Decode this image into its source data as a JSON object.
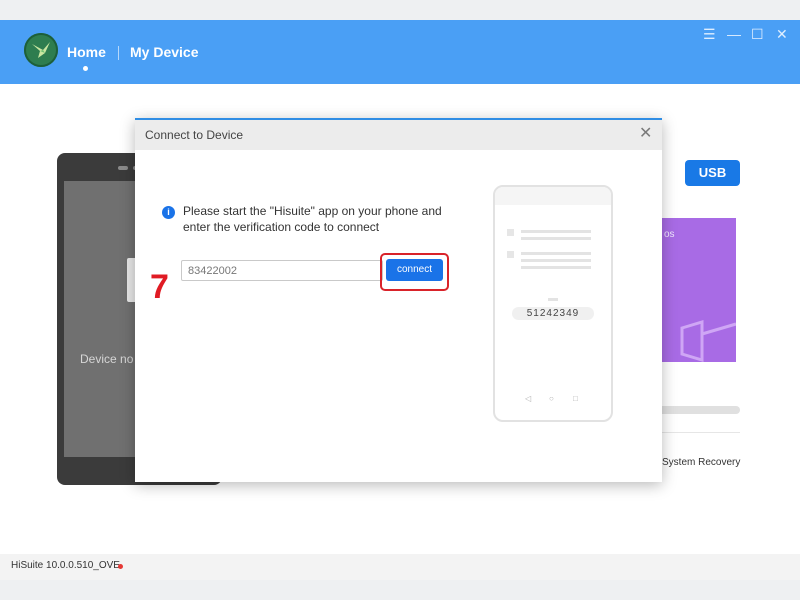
{
  "header": {
    "nav_home": "Home",
    "nav_my_device": "My Device",
    "menu_glyph": "☰",
    "minimize_glyph": "—",
    "maximize_glyph": "☐",
    "close_glyph": "✕"
  },
  "background": {
    "device_text": "Device no",
    "usb_label": "USB",
    "card_text": "os",
    "system_recovery": "System Recovery"
  },
  "dialog": {
    "title": "Connect to Device",
    "close_glyph": "✕",
    "info_glyph": "i",
    "instruction": "Please start the \"Hisuite\" app on your phone and enter the verification code to connect",
    "input_value": "83422002",
    "connect_label": "connect",
    "phone_code": "51242349",
    "phone_nav": [
      "◁",
      "○",
      "□"
    ]
  },
  "annotation": {
    "step_number": "7",
    "highlight_color": "#d9232a"
  },
  "status": {
    "version": "HiSuite 10.0.0.510_OVE"
  },
  "colors": {
    "titlebar": "#4a9ff5",
    "primary_button": "#1a73e8",
    "card_purple": "#a86be5"
  }
}
